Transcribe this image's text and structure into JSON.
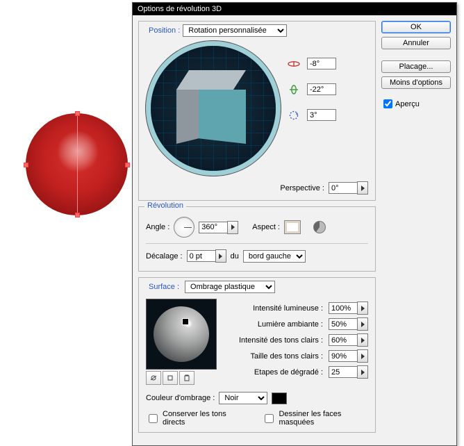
{
  "dialog": {
    "title": "Options de révolution 3D"
  },
  "buttons": {
    "ok": "OK",
    "cancel": "Annuler",
    "map_art": "Placage...",
    "fewer_options": "Moins d'options",
    "preview_label": "Aperçu"
  },
  "position": {
    "legend": "Position :",
    "preset": "Rotation personnalisée",
    "rot_x": "-8°",
    "rot_y": "-22°",
    "rot_z": "3°",
    "perspective_label": "Perspective :",
    "perspective": "0°"
  },
  "revolve": {
    "legend": "Révolution",
    "angle_label": "Angle :",
    "angle": "360°",
    "cap_label": "Aspect :",
    "offset_label": "Décalage :",
    "offset": "0 pt",
    "from_label": "du",
    "edge": "bord gauche"
  },
  "surface": {
    "legend": "Surface :",
    "shading": "Ombrage plastique",
    "light_intensity_label": "Intensité lumineuse :",
    "light_intensity": "100%",
    "ambient_label": "Lumière ambiante :",
    "ambient": "50%",
    "highlight_intensity_label": "Intensité des tons clairs :",
    "highlight_intensity": "60%",
    "highlight_size_label": "Taille des tons clairs :",
    "highlight_size": "90%",
    "blend_steps_label": "Etapes de dégradé :",
    "blend_steps": "25",
    "shade_color_label": "Couleur d'ombrage :",
    "shade_color": "Noir",
    "preserve_spot": "Conserver les tons directs",
    "draw_hidden": "Dessiner les faces masquées"
  }
}
